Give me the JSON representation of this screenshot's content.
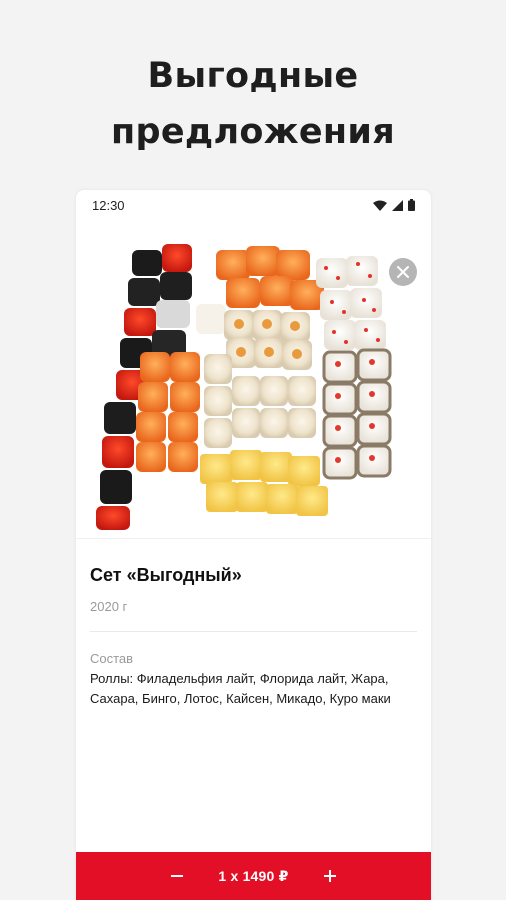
{
  "promo": {
    "headline_line1": "Выгодные",
    "headline_line2": "предложения"
  },
  "statusbar": {
    "time": "12:30",
    "icons": [
      "wifi-icon",
      "cell-signal-icon",
      "battery-icon"
    ]
  },
  "product": {
    "image": "sushi-set-photo",
    "close_icon": "close-icon",
    "title": "Сет «Выгодный»",
    "weight": "2020 г",
    "composition_label": "Состав",
    "composition_text": "Роллы: Филадельфия лайт, Флорида лайт, Жара, Сахара, Бинго, Лотос, Кайсен, Микадо, Куро маки"
  },
  "order": {
    "minus_icon": "minus-icon",
    "plus_icon": "plus-icon",
    "quantity_price": "1 x 1490 ₽"
  },
  "colors": {
    "accent": "#e30f27",
    "background": "#f3f3f3"
  }
}
